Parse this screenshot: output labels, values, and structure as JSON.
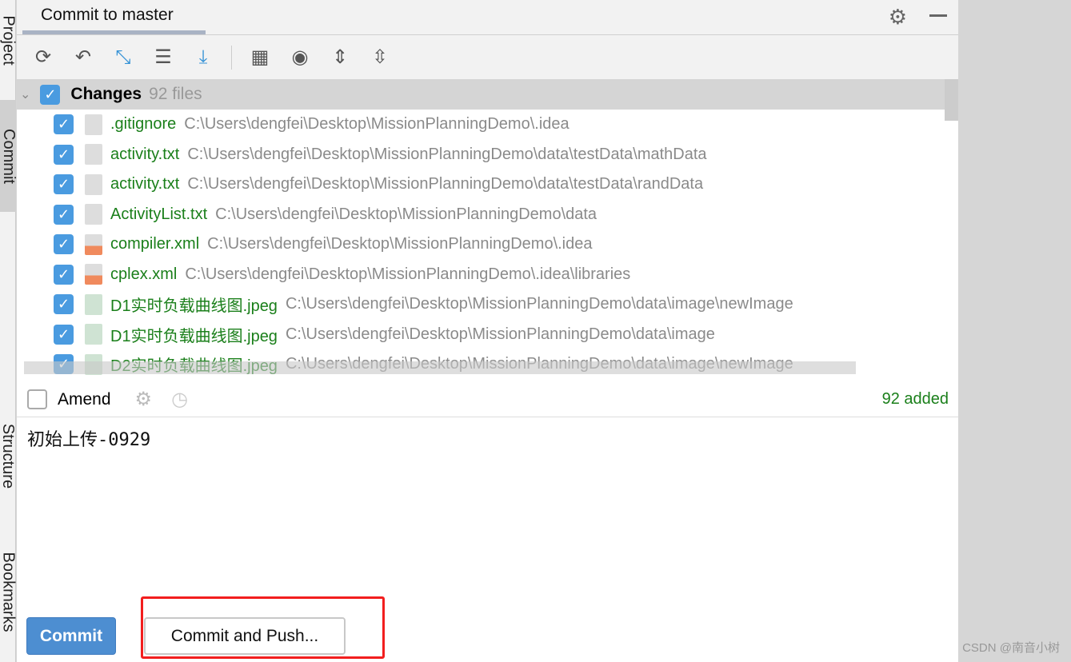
{
  "side_tabs": [
    "Project",
    "Commit",
    "Structure",
    "Bookmarks"
  ],
  "header": {
    "title": "Commit to master"
  },
  "toolbar": [
    "refresh-icon",
    "rollback-icon",
    "diff-icon",
    "shelve-icon",
    "update-icon",
    "group-by-icon",
    "view-options-icon",
    "expand-all-icon",
    "collapse-all-icon"
  ],
  "changes": {
    "label": "Changes",
    "count": "92 files",
    "files": [
      {
        "name": ".gitignore",
        "path": "C:\\Users\\dengfei\\Desktop\\MissionPlanningDemo\\.idea",
        "type": "ignore"
      },
      {
        "name": "activity.txt",
        "path": "C:\\Users\\dengfei\\Desktop\\MissionPlanningDemo\\data\\testData\\mathData",
        "type": "txt"
      },
      {
        "name": "activity.txt",
        "path": "C:\\Users\\dengfei\\Desktop\\MissionPlanningDemo\\data\\testData\\randData",
        "type": "txt"
      },
      {
        "name": "ActivityList.txt",
        "path": "C:\\Users\\dengfei\\Desktop\\MissionPlanningDemo\\data",
        "type": "txt"
      },
      {
        "name": "compiler.xml",
        "path": "C:\\Users\\dengfei\\Desktop\\MissionPlanningDemo\\.idea",
        "type": "xml"
      },
      {
        "name": "cplex.xml",
        "path": "C:\\Users\\dengfei\\Desktop\\MissionPlanningDemo\\.idea\\libraries",
        "type": "xml"
      },
      {
        "name": "D1实时负载曲线图.jpeg",
        "path": "C:\\Users\\dengfei\\Desktop\\MissionPlanningDemo\\data\\image\\newImage",
        "type": "img"
      },
      {
        "name": "D1实时负载曲线图.jpeg",
        "path": "C:\\Users\\dengfei\\Desktop\\MissionPlanningDemo\\data\\image",
        "type": "img"
      },
      {
        "name": "D2实时负载曲线图.jpeg",
        "path": "C:\\Users\\dengfei\\Desktop\\MissionPlanningDemo\\data\\image\\newImage",
        "type": "img"
      }
    ]
  },
  "amend": {
    "label": "Amend",
    "checked": false,
    "status": "92 added"
  },
  "message": "初始上传-0929",
  "buttons": {
    "commit": "Commit",
    "commit_push": "Commit and Push..."
  },
  "watermark": "CSDN @南音小树",
  "colors": {
    "accent": "#4a9be0",
    "added": "#1a7f1a",
    "highlight": "#f21e1e"
  }
}
